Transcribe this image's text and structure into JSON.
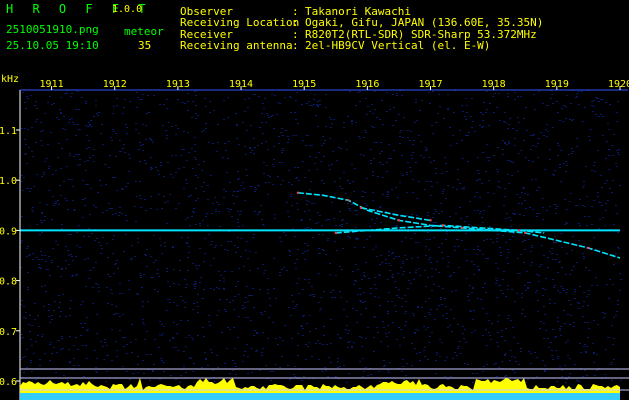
{
  "header": {
    "app_name": "H R O F F T",
    "version": "1.0.0",
    "filename": "2510051910.png",
    "datetime": "25.10.05 19:10",
    "count_label": "meteor",
    "count_value": "35",
    "info": [
      {
        "key": "Observer",
        "sep": ":",
        "value": "Takanori Kawachi"
      },
      {
        "key": "Receiving Location",
        "sep": ":",
        "value": "Ogaki, Gifu, JAPAN (136.60E, 35.35N)"
      },
      {
        "key": "Receiver",
        "sep": ":",
        "value": "R820T2(RTL-SDR) SDR-Sharp 53.372MHz"
      },
      {
        "key": "Receiving antenna",
        "sep": ":",
        "value": "2el-HB9CV Vertical (el. E-W)"
      }
    ]
  },
  "colors": {
    "background": "#000000",
    "noise": "#0a1a6a",
    "text_green": "#00ff00",
    "text_yellow": "#ffff00",
    "axis": "#ffffff",
    "signal": "#00e5ff",
    "bar_yellow": "#ffff00",
    "bar_cyan": "#33ccff"
  },
  "chart_data": {
    "type": "scatter",
    "ylabel": "kHz",
    "x_ticks": [
      "1911",
      "1912",
      "1913",
      "1914",
      "1915",
      "1916",
      "1917",
      "1918",
      "1919",
      "1920"
    ],
    "y_ticks": [
      "1.1",
      "1.0",
      "0.9",
      "0.8",
      "0.7",
      "0.6"
    ],
    "ylim": [
      0.6,
      1.15
    ],
    "xlim": [
      1910.5,
      1920
    ],
    "series": [
      {
        "x": [
          1910.5,
          1920
        ],
        "y": [
          0.9,
          0.9
        ]
      },
      {
        "x": [
          1914.9,
          1915.3,
          1915.7,
          1916.0,
          1916.5,
          1917.0,
          1917.5,
          1918.0,
          1918.5,
          1919.0,
          1919.5,
          1920.0
        ],
        "y": [
          0.975,
          0.97,
          0.96,
          0.94,
          0.92,
          0.91,
          0.905,
          0.9,
          0.895,
          0.88,
          0.865,
          0.845
        ]
      },
      {
        "x": [
          1915.9,
          1916.5,
          1917.0
        ],
        "y": [
          0.945,
          0.93,
          0.92
        ]
      },
      {
        "x": [
          1915.5,
          1916.5,
          1917.2,
          1917.8,
          1918.4,
          1918.8
        ],
        "y": [
          0.895,
          0.905,
          0.91,
          0.905,
          0.9,
          0.895
        ]
      }
    ],
    "grid": false
  }
}
